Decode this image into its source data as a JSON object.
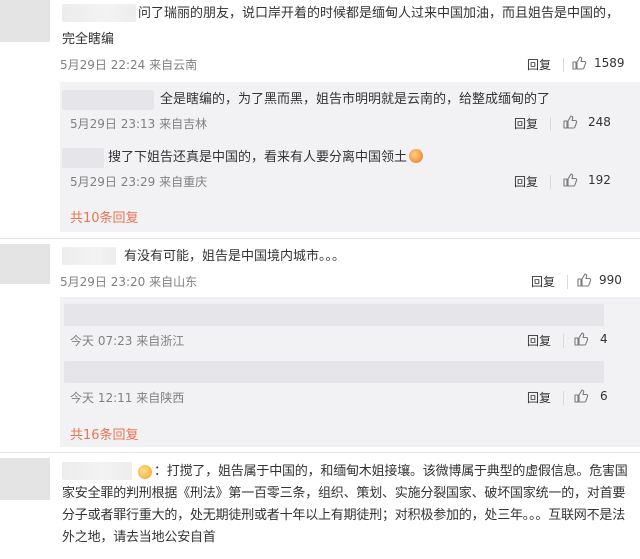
{
  "comments": [
    {
      "text_line1": "问了瑞丽的朋友，说口岸开着的时候都是缅甸人过来中国加油，而且姐告是中国的，",
      "text_line2": "完全瞎编",
      "time": "5月29日 22:24 来自云南",
      "reply_label": "回复",
      "likes": "1589",
      "replies": [
        {
          "text": "全是瞎编的，为了黑而黑，姐告市明明就是云南的，给整成缅甸的了",
          "time": "5月29日 23:13 来自吉林",
          "reply_label": "回复",
          "likes": "248"
        },
        {
          "text": "搜了下姐告还真是中国的，看来有人要分离中国领土",
          "time": "5月29日 23:29 来自重庆",
          "reply_label": "回复",
          "likes": "192"
        }
      ],
      "more_link": "共10条回复"
    },
    {
      "text": "有没有可能，姐告是中国境内城市。。。",
      "time": "5月29日 23:20 来自山东",
      "reply_label": "回复",
      "likes": "990",
      "replies": [
        {
          "time": "今天 07:23 来自浙江",
          "reply_label": "回复",
          "likes": "4"
        },
        {
          "time": "今天 12:11 来自陕西",
          "reply_label": "回复",
          "likes": "6"
        }
      ],
      "more_link": "共16条回复"
    },
    {
      "text": "：打搅了，姐告属于中国的，和缅甸木姐接壤。该微博属于典型的虚假信息。危害国家安全罪的判刑根据《刑法》第一百零三条，组织、策划、实施分裂国家、破坏国家统一的，对首要分子或者罪行重大的，处无期徒刑或者十年以上有期徒刑；对积极参加的，处三年。。。互联网不是法外之地，请去当地公安自首"
    }
  ],
  "colors": {
    "link": "#eb7350",
    "meta": "#808080",
    "text": "#333333",
    "subbox": "#f2f2f5"
  },
  "icons": {
    "like": "thumbs-up-icon",
    "emoji": "face-emoji-icon"
  }
}
